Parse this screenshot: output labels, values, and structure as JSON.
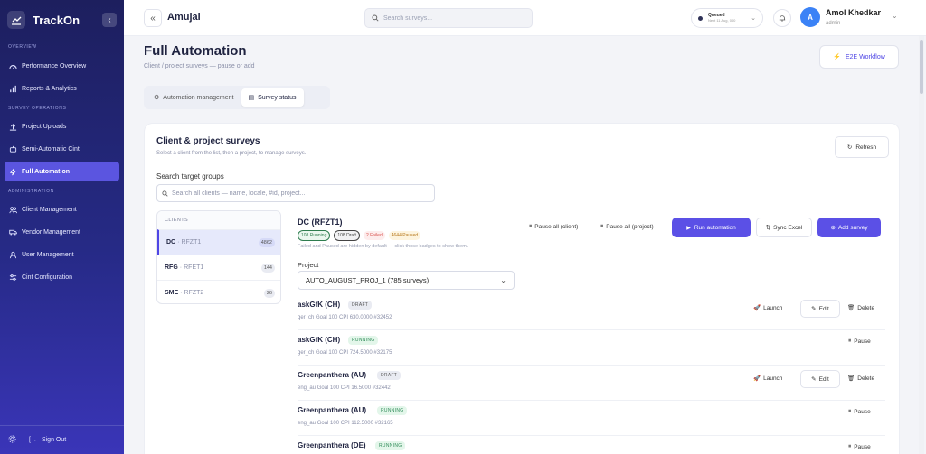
{
  "sidebar": {
    "brand": "TrackOn",
    "sections": [
      {
        "label": "OVERVIEW",
        "items": [
          "Performance Overview",
          "Reports & Analytics"
        ]
      },
      {
        "label": "SURVEY OPERATIONS",
        "items": [
          "Project Uploads",
          "Semi-Automatic Cint",
          "Full Automation"
        ]
      },
      {
        "label": "ADMINISTRATION",
        "items": [
          "Client Management",
          "Vendor Management",
          "User Management",
          "Cint Configuration"
        ]
      }
    ],
    "sign_out": "Sign Out"
  },
  "header": {
    "title": "Amujal",
    "search_placeholder": "Search surveys...",
    "queue_status": "Queued",
    "queue_next": "Next 11 Aug, 000",
    "avatar_initial": "A",
    "user_name": "Amol Khedkar",
    "user_role": "admin"
  },
  "page": {
    "title": "Full Automation",
    "subtitle": "Client / project surveys — pause or add",
    "e2e_label": "E2E Workflow",
    "tabs": [
      "Automation management",
      "Survey status"
    ]
  },
  "card": {
    "title": "Client & project surveys",
    "subtitle": "Select a client from the list, then a project, to manage surveys.",
    "refresh_label": "Refresh",
    "target_label": "Search target groups",
    "target_placeholder": "Search all clients — name, locale, #id, project...",
    "clients_header": "CLIENTS",
    "clients": [
      {
        "name": "DC",
        "code": "RFZT1",
        "count": "4862"
      },
      {
        "name": "RFG",
        "code": "RFET1",
        "count": "144"
      },
      {
        "name": "SME",
        "code": "RFZT2",
        "count": "26"
      }
    ]
  },
  "detail": {
    "title": "DC (RFZT1)",
    "badges": {
      "running": "108 Running",
      "draft": "108 Draft",
      "failed": "2 Failed",
      "paused": "4644 Paused"
    },
    "hint": "Failed and Paused are hidden by default — click those badges to show them.",
    "pause_client": "Pause all (client)",
    "pause_project": "Pause all (project)",
    "run_label": "Run automation",
    "sync_label": "Sync Excel",
    "add_label": "Add survey",
    "project_label": "Project",
    "project_value": "AUTO_AUGUST_PROJ_1 (785 surveys)"
  },
  "surveys": [
    {
      "name": "askGfK (CH)",
      "status": "DRAFT",
      "meta": "ger_ch  Goal 100  CPI 630.0000  #32452"
    },
    {
      "name": "askGfK (CH)",
      "status": "RUNNING",
      "meta": "ger_ch  Goal 100  CPI 724.5000  #32175"
    },
    {
      "name": "Greenpanthera (AU)",
      "status": "DRAFT",
      "meta": "eng_au  Goal 100  CPI 16.5000  #32442"
    },
    {
      "name": "Greenpanthera (AU)",
      "status": "RUNNING",
      "meta": "eng_au  Goal 100  CPI 112.5000  #32165"
    },
    {
      "name": "Greenpanthera (DE)",
      "status": "RUNNING",
      "meta": ""
    }
  ],
  "actions": {
    "launch": "Launch",
    "edit": "Edit",
    "delete": "Delete",
    "pause": "Pause"
  }
}
